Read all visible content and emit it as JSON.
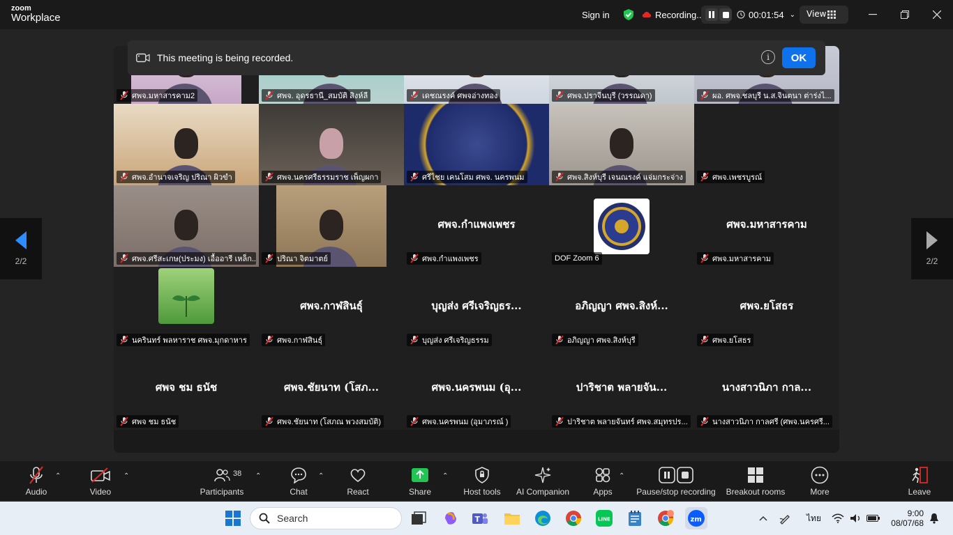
{
  "titlebar": {
    "logo_line1": "zoom",
    "logo_line2": "Workplace",
    "sign_in": "Sign in",
    "recording_label": "Recording...",
    "timer": "00:01:54",
    "view_label": "View"
  },
  "banner": {
    "message": "This meeting is being recorded.",
    "ok_label": "OK"
  },
  "pager": {
    "left": "2/2",
    "right": "2/2"
  },
  "tiles": [
    {
      "name": "ศพจ.มหาสารคาม2"
    },
    {
      "name": "ศพจ. อุดรธานี_สมบัติ สิงห์ลี"
    },
    {
      "name": "เดชณรงค์          ศพจอ่างทอง"
    },
    {
      "name": "ศพจ.ปราจีนบุรี (วรรณดา)"
    },
    {
      "name": "ผอ. ศพจ.ชลบุรี น.ส.จินตนา  ต่าร่งไ..."
    },
    {
      "name": "ศพจ.อำนาจเจริญ ปริณา ผิวขำ"
    },
    {
      "name": "ศพจ.นครศรีธรรมราช เพ็ญผกา"
    },
    {
      "name": "ศรีไชย เคนโสม ศพจ. นครพนม"
    },
    {
      "name": "ศพจ.สิงห์บุรี เจนณรงค์ แจ่มกระจ่าง"
    },
    {
      "name": "ศพจ.เพชรบูรณ์"
    },
    {
      "name": "ศพจ.ศรีสะเกษ(ประมง) เอื้ออารี เหล็ก..."
    },
    {
      "name": "ปริณา จิตมาตย์"
    },
    {
      "name": "ศพจ.กำแพงเพชร",
      "big": "ศพจ.กำแพงเพชร"
    },
    {
      "name": "DOF Zoom 6"
    },
    {
      "name": "ศพจ.มหาสารคาม",
      "big": "ศพจ.มหาสารคาม"
    },
    {
      "name": "นครินทร์ พลหาราช  ศพจ.มุกดาหาร"
    },
    {
      "name": "ศพจ.กาฬสินธุ์",
      "big": "ศพจ.กาฬสินธุ์"
    },
    {
      "name": "บุญส่ง  ศรีเจริญธรรม",
      "big": "บุญส่ง  ศรีเจริญธร..."
    },
    {
      "name": "อภิญญา ศพจ.สิงห์บุรี",
      "big": "อภิญญา ศพจ.สิงห์..."
    },
    {
      "name": "ศพจ.ยโสธร",
      "big": "ศพจ.ยโสธร"
    },
    {
      "name": "ศพจ ชม ธนัช",
      "big": "ศพจ ชม ธนัช"
    },
    {
      "name": "ศพจ.ชัยนาท (โสภณ พวงสมบัติ)",
      "big": "ศพจ.ชัยนาท (โสภ..."
    },
    {
      "name": "ศพจ.นครพนม (อุมาภรณ์ )",
      "big": "ศพจ.นครพนม (อุ..."
    },
    {
      "name": "ปาริชาต พลายจันทร์ ศพจ.สมุทรปร...",
      "big": "ปาริชาต พลายจัน..."
    },
    {
      "name": "นางสาวนิภา  กาลศรี (ศพจ.นครศรี...",
      "big": "นางสาวนิภา  กาล..."
    }
  ],
  "toolbar": {
    "audio": "Audio",
    "video": "Video",
    "participants": "Participants",
    "participants_count": "38",
    "chat": "Chat",
    "react": "React",
    "share": "Share",
    "host_tools": "Host tools",
    "ai_companion": "AI Companion",
    "apps": "Apps",
    "pause_recording": "Pause/stop recording",
    "breakout_rooms": "Breakout rooms",
    "more": "More",
    "leave": "Leave"
  },
  "taskbar": {
    "search_placeholder": "Search",
    "language": "ไทย",
    "time": "9:00",
    "date": "08/07/68"
  },
  "colors": {
    "accent": "#0e72ed",
    "recording": "#e02828",
    "share_green": "#23c552",
    "muted_red": "#e02828"
  }
}
